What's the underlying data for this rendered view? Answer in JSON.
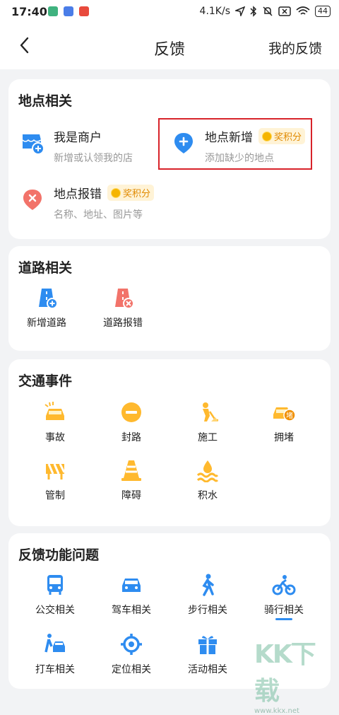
{
  "status": {
    "time": "17:40",
    "speed": "4.1K/s",
    "battery": "44"
  },
  "nav": {
    "title": "反馈",
    "my_feedback": "我的反馈"
  },
  "place": {
    "title": "地点相关",
    "items": [
      {
        "name": "我是商户",
        "desc": "新增或认领我的店",
        "icon": "store-add-icon"
      },
      {
        "name": "地点新增",
        "desc": "添加缺少的地点",
        "badge": "奖积分",
        "icon": "place-add-icon"
      },
      {
        "name": "地点报错",
        "desc": "名称、地址、图片等",
        "badge": "奖积分",
        "icon": "place-error-icon"
      }
    ]
  },
  "road": {
    "title": "道路相关",
    "items": [
      {
        "label": "新增道路",
        "icon": "road-add-icon"
      },
      {
        "label": "道路报错",
        "icon": "road-error-icon"
      }
    ]
  },
  "traffic": {
    "title": "交通事件",
    "items": [
      {
        "label": "事故",
        "icon": "accident-icon"
      },
      {
        "label": "封路",
        "icon": "road-closed-icon"
      },
      {
        "label": "施工",
        "icon": "construction-icon"
      },
      {
        "label": "拥堵",
        "icon": "congestion-icon",
        "tag": "堵"
      },
      {
        "label": "管制",
        "icon": "control-icon"
      },
      {
        "label": "障碍",
        "icon": "obstacle-icon"
      },
      {
        "label": "积水",
        "icon": "flood-icon"
      }
    ]
  },
  "functions": {
    "title": "反馈功能问题",
    "items": [
      {
        "label": "公交相关",
        "icon": "bus-icon"
      },
      {
        "label": "驾车相关",
        "icon": "car-icon"
      },
      {
        "label": "步行相关",
        "icon": "walk-icon"
      },
      {
        "label": "骑行相关",
        "icon": "bike-icon"
      },
      {
        "label": "打车相关",
        "icon": "taxi-icon"
      },
      {
        "label": "定位相关",
        "icon": "location-icon"
      },
      {
        "label": "活动相关",
        "icon": "gift-icon"
      }
    ]
  },
  "watermark": {
    "big": "KK下载",
    "small": "www.kkx.net"
  },
  "colors": {
    "blue": "#2e8cf0",
    "orange": "#ffb92e",
    "red": "#f2736a"
  }
}
